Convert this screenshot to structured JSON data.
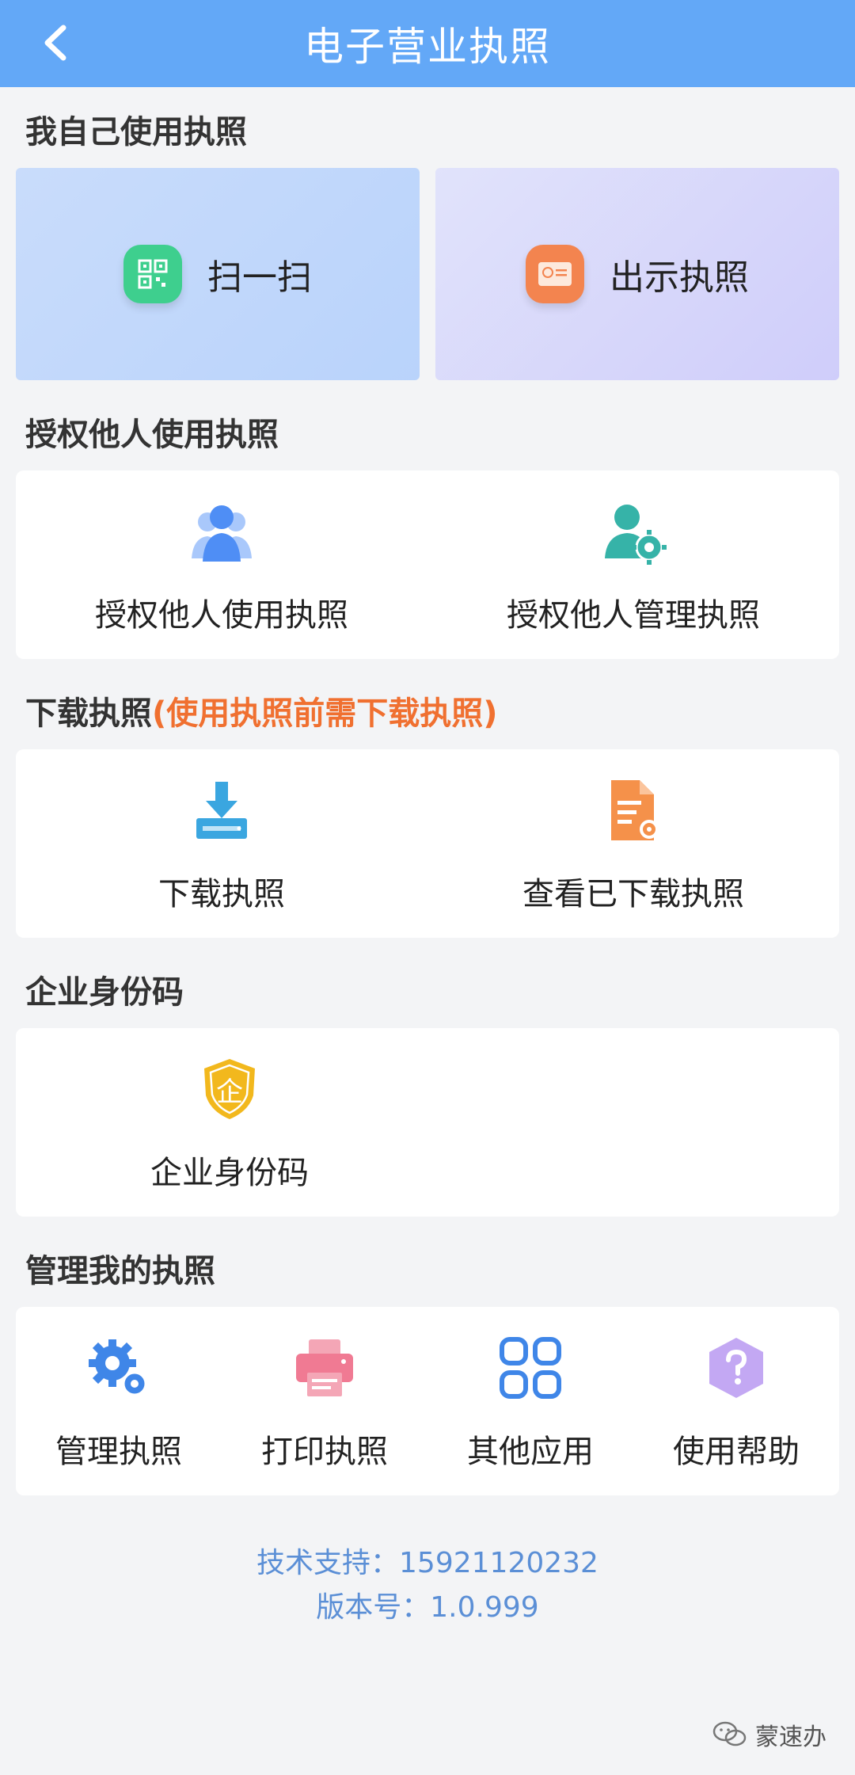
{
  "header": {
    "title": "电子营业执照"
  },
  "self_use": {
    "title": "我自己使用执照",
    "scan_label": "扫一扫",
    "show_label": "出示执照"
  },
  "authorize": {
    "title": "授权他人使用执照",
    "items": [
      {
        "label": "授权他人使用执照"
      },
      {
        "label": "授权他人管理执照"
      }
    ]
  },
  "download": {
    "title": "下载执照",
    "note": "(使用执照前需下载执照)",
    "items": [
      {
        "label": "下载执照"
      },
      {
        "label": "查看已下载执照"
      }
    ]
  },
  "enterprise_id": {
    "title": "企业身份码",
    "item_label": "企业身份码",
    "badge_char": "企"
  },
  "manage": {
    "title": "管理我的执照",
    "items": [
      {
        "label": "管理执照"
      },
      {
        "label": "打印执照"
      },
      {
        "label": "其他应用"
      },
      {
        "label": "使用帮助"
      }
    ]
  },
  "footer": {
    "support": "技术支持：15921120232",
    "version": "版本号：1.0.999"
  },
  "watermark": "蒙速办",
  "colors": {
    "header": "#63a8f7",
    "accent_orange": "#f07030",
    "icon_blue": "#4f8ef5",
    "icon_green": "#3ecf8e",
    "icon_teal": "#36b3a8",
    "icon_gold": "#f2b81d",
    "icon_pink": "#f07a93",
    "icon_purple": "#b89cf0"
  }
}
